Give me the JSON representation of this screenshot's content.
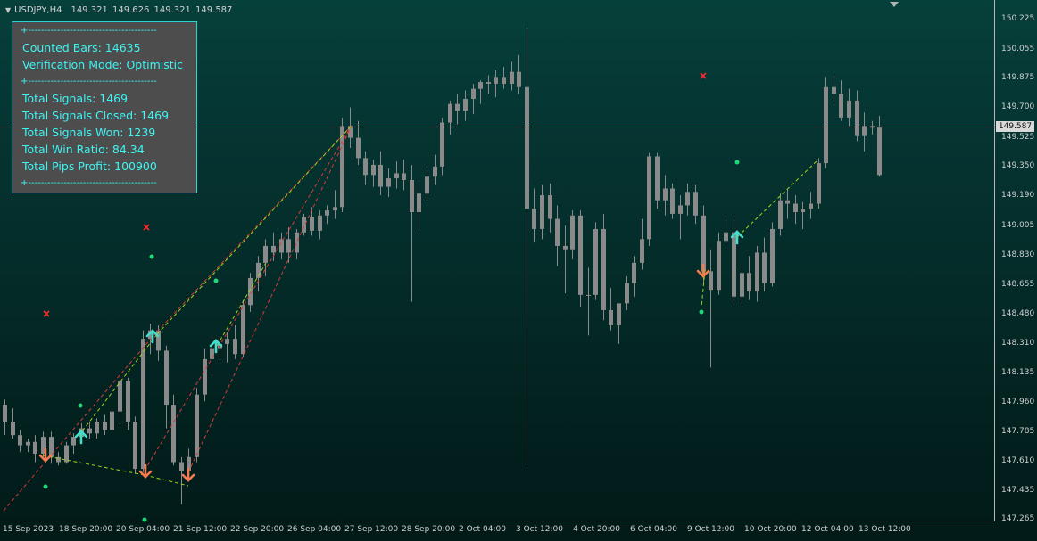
{
  "header": {
    "symbol": "USDJPY,H4",
    "ohlc": "149.321 149.626 149.321 149.587"
  },
  "info_panel": {
    "separator": "+----------------------------------------",
    "counted_bars": "Counted Bars: 14635",
    "verification_mode": "Verification Mode: Optimistic",
    "total_signals": "Total Signals: 1469",
    "total_signals_closed": "Total Signals Closed: 1469",
    "total_signals_won": "Total Signals Won: 1239",
    "total_win_ratio": "Total Win Ratio: 84.34",
    "total_pips_profit": "Total Pips Profit: 100900"
  },
  "price_axis": {
    "labels": [
      "150.225",
      "150.055",
      "149.875",
      "149.700",
      "149.525",
      "149.350",
      "149.190",
      "149.005",
      "148.830",
      "148.655",
      "148.480",
      "148.310",
      "148.135",
      "147.960",
      "147.785",
      "147.610",
      "147.435",
      "147.265"
    ],
    "current_price": "149.587"
  },
  "time_axis": {
    "labels": [
      "15 Sep 2023",
      "18 Sep 20:00",
      "20 Sep 04:00",
      "21 Sep 12:00",
      "22 Sep 20:00",
      "26 Sep 04:00",
      "27 Sep 12:00",
      "28 Sep 20:00",
      "2 Oct 04:00",
      "3 Oct 12:00",
      "4 Oct 20:00",
      "6 Oct 04:00",
      "9 Oct 12:00",
      "10 Oct 20:00",
      "12 Oct 04:00",
      "13 Oct 12:00"
    ]
  },
  "colors": {
    "candle": "#8a8a8a",
    "buy_arrow": "#45dccb",
    "sell_arrow": "#f47a50",
    "win_dot": "#22d97a",
    "loss_mark": "#ff2a2a",
    "green_line": "#9cd61c",
    "red_line": "#d83a3a",
    "panel_text": "#3ff4f4",
    "panel_border": "#29d3d6",
    "panel_bg": "#4d4d4d"
  },
  "candles": [
    [
      147.94,
      147.97,
      147.76,
      147.84
    ],
    [
      147.84,
      147.92,
      147.74,
      147.76
    ],
    [
      147.76,
      147.79,
      147.66,
      147.7
    ],
    [
      147.7,
      147.74,
      147.66,
      147.72
    ],
    [
      147.72,
      147.76,
      147.6,
      147.65
    ],
    [
      147.65,
      147.78,
      147.63,
      147.75
    ],
    [
      147.75,
      147.78,
      147.59,
      147.63
    ],
    [
      147.63,
      147.66,
      147.58,
      147.6
    ],
    [
      147.6,
      147.72,
      147.59,
      147.7
    ],
    [
      147.7,
      147.77,
      147.65,
      147.75
    ],
    [
      147.75,
      147.83,
      147.72,
      147.8
    ],
    [
      147.8,
      147.84,
      147.74,
      147.77
    ],
    [
      147.77,
      147.86,
      147.74,
      147.84
    ],
    [
      147.84,
      147.88,
      147.76,
      147.79
    ],
    [
      147.79,
      147.92,
      147.78,
      147.9
    ],
    [
      147.9,
      148.12,
      147.84,
      148.08
    ],
    [
      148.08,
      148.1,
      147.79,
      147.84
    ],
    [
      147.84,
      147.87,
      147.53,
      147.56
    ],
    [
      147.56,
      148.38,
      147.54,
      148.33
    ],
    [
      148.33,
      148.42,
      148.24,
      148.38
    ],
    [
      148.38,
      148.41,
      148.2,
      148.26
    ],
    [
      148.26,
      148.29,
      147.8,
      147.94
    ],
    [
      147.94,
      148.0,
      147.58,
      147.6
    ],
    [
      147.6,
      147.63,
      147.35,
      147.55
    ],
    [
      147.55,
      147.68,
      147.51,
      147.63
    ],
    [
      147.63,
      148.04,
      147.6,
      148.0
    ],
    [
      148.0,
      148.27,
      147.96,
      148.21
    ],
    [
      148.21,
      148.34,
      148.11,
      148.27
    ],
    [
      148.27,
      148.35,
      148.22,
      148.3
    ],
    [
      148.3,
      148.37,
      148.19,
      148.33
    ],
    [
      148.33,
      148.41,
      148.21,
      148.24
    ],
    [
      148.24,
      148.56,
      148.22,
      148.53
    ],
    [
      148.53,
      148.72,
      148.49,
      148.69
    ],
    [
      148.69,
      148.82,
      148.61,
      148.78
    ],
    [
      148.78,
      148.92,
      148.7,
      148.88
    ],
    [
      148.88,
      148.96,
      148.79,
      148.84
    ],
    [
      148.84,
      148.96,
      148.8,
      148.92
    ],
    [
      148.92,
      148.99,
      148.78,
      148.84
    ],
    [
      148.84,
      148.98,
      148.8,
      148.96
    ],
    [
      148.96,
      149.07,
      148.94,
      149.05
    ],
    [
      149.05,
      149.11,
      148.94,
      148.97
    ],
    [
      148.97,
      149.09,
      148.92,
      149.06
    ],
    [
      149.06,
      149.12,
      149.01,
      149.09
    ],
    [
      149.09,
      149.21,
      149.04,
      149.11
    ],
    [
      149.11,
      149.64,
      149.08,
      149.59
    ],
    [
      149.59,
      149.7,
      149.46,
      149.52
    ],
    [
      149.52,
      149.62,
      149.36,
      149.4
    ],
    [
      149.4,
      149.44,
      149.24,
      149.3
    ],
    [
      149.3,
      149.39,
      149.23,
      149.36
    ],
    [
      149.36,
      149.44,
      149.18,
      149.23
    ],
    [
      149.23,
      149.34,
      149.17,
      149.28
    ],
    [
      149.28,
      149.38,
      149.22,
      149.31
    ],
    [
      149.31,
      149.39,
      149.21,
      149.27
    ],
    [
      149.27,
      149.36,
      148.55,
      149.08
    ],
    [
      149.08,
      149.25,
      148.95,
      149.19
    ],
    [
      149.19,
      149.33,
      149.15,
      149.29
    ],
    [
      149.29,
      149.42,
      149.24,
      149.35
    ],
    [
      149.35,
      149.64,
      149.3,
      149.61
    ],
    [
      149.61,
      149.74,
      149.54,
      149.72
    ],
    [
      149.72,
      149.78,
      149.6,
      149.68
    ],
    [
      149.68,
      149.8,
      149.62,
      149.75
    ],
    [
      149.75,
      149.84,
      149.66,
      149.81
    ],
    [
      149.81,
      149.86,
      149.72,
      149.85
    ],
    [
      149.85,
      149.89,
      149.78,
      149.84
    ],
    [
      149.84,
      149.92,
      149.76,
      149.88
    ],
    [
      149.88,
      149.94,
      149.81,
      149.84
    ],
    [
      149.84,
      149.97,
      149.8,
      149.91
    ],
    [
      149.91,
      150.01,
      149.78,
      149.82
    ],
    [
      149.82,
      150.17,
      147.58,
      149.1
    ],
    [
      149.1,
      149.22,
      148.9,
      148.98
    ],
    [
      148.98,
      149.24,
      148.92,
      149.18
    ],
    [
      149.18,
      149.25,
      148.96,
      149.04
    ],
    [
      149.04,
      149.12,
      148.76,
      148.88
    ],
    [
      148.88,
      149.0,
      148.6,
      148.86
    ],
    [
      148.86,
      149.09,
      148.8,
      149.06
    ],
    [
      149.06,
      149.09,
      148.52,
      148.59
    ],
    [
      148.59,
      148.75,
      148.35,
      148.59
    ],
    [
      148.59,
      149.02,
      148.56,
      148.98
    ],
    [
      148.98,
      149.07,
      148.44,
      148.5
    ],
    [
      148.5,
      148.63,
      148.38,
      148.41
    ],
    [
      148.41,
      148.53,
      148.3,
      148.54
    ],
    [
      148.54,
      148.7,
      148.5,
      148.66
    ],
    [
      148.66,
      148.82,
      148.58,
      148.78
    ],
    [
      148.78,
      149.04,
      148.74,
      148.92
    ],
    [
      148.92,
      149.43,
      148.88,
      149.41
    ],
    [
      149.41,
      149.43,
      149.1,
      149.15
    ],
    [
      149.15,
      149.3,
      149.06,
      149.22
    ],
    [
      149.22,
      149.25,
      149.04,
      149.07
    ],
    [
      149.07,
      149.18,
      148.92,
      149.12
    ],
    [
      149.12,
      149.25,
      149.06,
      149.2
    ],
    [
      149.2,
      149.24,
      149.01,
      149.06
    ],
    [
      149.06,
      149.12,
      148.66,
      148.73
    ],
    [
      148.73,
      148.86,
      148.16,
      148.62
    ],
    [
      148.62,
      148.96,
      148.59,
      148.91
    ],
    [
      148.91,
      149.06,
      148.88,
      148.96
    ],
    [
      148.96,
      149.06,
      148.53,
      148.58
    ],
    [
      148.58,
      148.76,
      148.54,
      148.72
    ],
    [
      148.72,
      148.82,
      148.56,
      148.61
    ],
    [
      148.61,
      148.88,
      148.55,
      148.84
    ],
    [
      148.84,
      148.93,
      148.61,
      148.66
    ],
    [
      148.66,
      149.02,
      148.64,
      148.98
    ],
    [
      148.98,
      149.19,
      148.94,
      149.15
    ],
    [
      149.15,
      149.22,
      149.04,
      149.13
    ],
    [
      149.13,
      149.18,
      149.01,
      149.08
    ],
    [
      149.08,
      149.14,
      148.98,
      149.1
    ],
    [
      149.1,
      149.2,
      149.04,
      149.13
    ],
    [
      149.13,
      149.4,
      149.1,
      149.37
    ],
    [
      149.37,
      149.88,
      149.34,
      149.82
    ],
    [
      149.82,
      149.89,
      149.71,
      149.78
    ],
    [
      149.78,
      149.86,
      149.62,
      149.64
    ],
    [
      149.64,
      149.81,
      149.59,
      149.74
    ],
    [
      149.74,
      149.8,
      149.5,
      149.53
    ],
    [
      149.53,
      149.67,
      149.44,
      149.59
    ],
    [
      149.59,
      149.62,
      149.54,
      149.58
    ],
    [
      149.58,
      149.65,
      149.29,
      149.3
    ]
  ]
}
